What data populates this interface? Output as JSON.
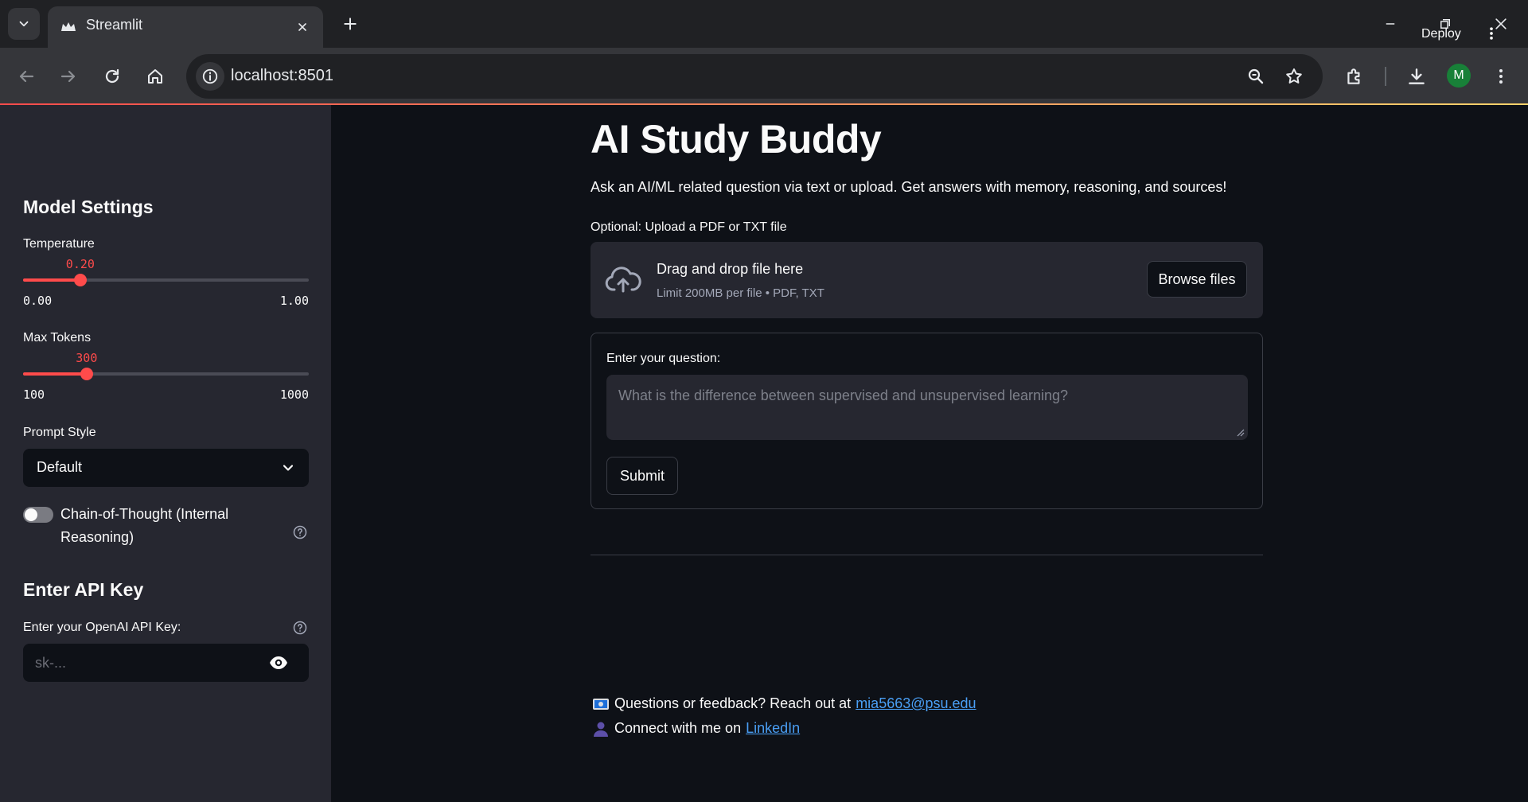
{
  "browser": {
    "tab_title": "Streamlit",
    "url": "localhost:8501",
    "profile_initial": "M"
  },
  "sidebar": {
    "model_settings_heading": "Model Settings",
    "temperature": {
      "label": "Temperature",
      "value": 0.2,
      "value_text": "0.20",
      "min_text": "0.00",
      "max_text": "1.00",
      "min": 0,
      "max": 1
    },
    "max_tokens": {
      "label": "Max Tokens",
      "value": 300,
      "value_text": "300",
      "min_text": "100",
      "max_text": "1000",
      "min": 100,
      "max": 1000
    },
    "prompt_style": {
      "label": "Prompt Style",
      "selected": "Default"
    },
    "cot_toggle": {
      "label": "Chain-of-Thought (Internal Reasoning)",
      "on": false
    },
    "api_heading": "Enter API Key",
    "api_key": {
      "label": "Enter your OpenAI API Key:",
      "placeholder": "sk-..."
    }
  },
  "header": {
    "deploy_label": "Deploy"
  },
  "main": {
    "title": "AI Study Buddy",
    "subtitle": "Ask an AI/ML related question via text or upload. Get answers with memory, reasoning, and sources!",
    "uploader": {
      "label": "Optional: Upload a PDF or TXT file",
      "drop_text": "Drag and drop file here",
      "limit_text": "Limit 200MB per file • PDF, TXT",
      "browse_label": "Browse files"
    },
    "form": {
      "question_label": "Enter your question:",
      "question_placeholder": "What is the difference between supervised and unsupervised learning?",
      "submit_label": "Submit"
    },
    "footer": {
      "feedback_text": "Questions or feedback? Reach out at",
      "email": "mia5663@psu.edu",
      "connect_text": "Connect with me on",
      "linkedin": "LinkedIn"
    }
  },
  "colors": {
    "accent": "#ff4b4b",
    "link": "#4a9ff5",
    "sidebar_bg": "#262730",
    "main_bg": "#0e1117"
  }
}
